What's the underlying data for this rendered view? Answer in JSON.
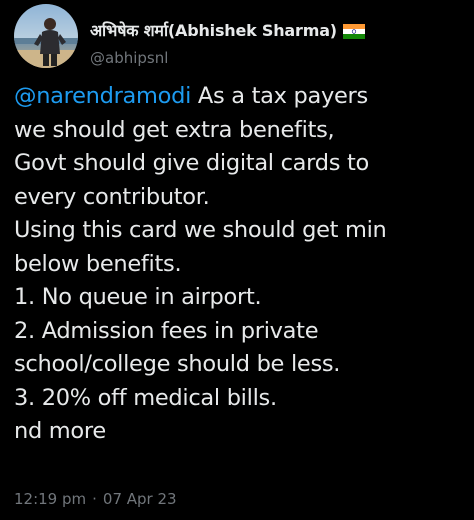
{
  "user": {
    "display_name": "अभिषेक शर्मा(Abhishek Sharma)",
    "handle": "@abhipsnl",
    "flag_icon": "india-flag-icon"
  },
  "tweet": {
    "mention": "@narendramodi",
    "first_line_rest": " As a tax payers",
    "lines": [
      "we should get extra benefits,",
      "Govt should give digital cards to",
      "every contributor.",
      "Using this card we should get min",
      "below benefits.",
      "1. No queue in airport.",
      "2. Admission fees in private",
      "school/college should be less.",
      "3. 20% off medical bills.",
      "nd more"
    ]
  },
  "meta": {
    "time": "12:19 pm",
    "separator": "·",
    "date": "07 Apr 23"
  },
  "colors": {
    "background": "#000000",
    "text": "#e7e9ea",
    "secondary": "#71767b",
    "link": "#1d9bf0"
  }
}
